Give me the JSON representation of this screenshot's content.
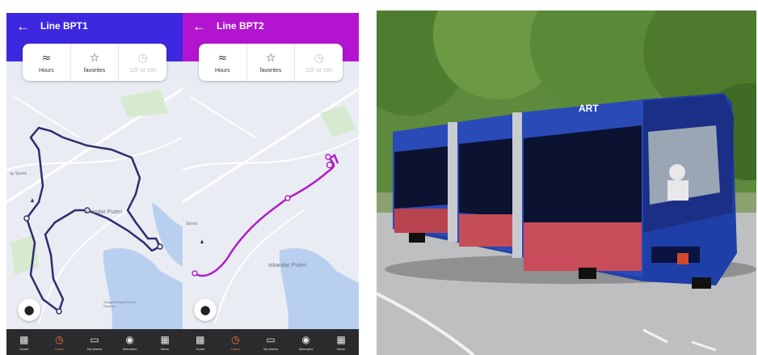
{
  "screens": [
    {
      "title": "Line BPT1",
      "route_color": "#2b2e6e",
      "appbar_color": "#3d28e0",
      "chips": [
        {
          "icon": "clock-schedule-icon",
          "label": "Hours"
        },
        {
          "icon": "star-icon",
          "label": "favorites"
        },
        {
          "icon": "clock-icon",
          "label": "12h at 18h"
        }
      ],
      "map_labels": [
        "Iskandar Puteri",
        "ay Sports",
        "Sungai Perepat Forest Reserve"
      ],
      "nav": [
        "Home",
        "Hours",
        "My tickets",
        "Itineraries",
        "Menu"
      ],
      "active_nav": "Hours"
    },
    {
      "title": "Line BPT2",
      "route_color": "#b01dc6",
      "appbar_color": "#b214cf",
      "chips": [
        {
          "icon": "clock-schedule-icon",
          "label": "Hours"
        },
        {
          "icon": "star-icon",
          "label": "favorites"
        },
        {
          "icon": "clock-icon",
          "label": "12h at 18h"
        }
      ],
      "map_labels": [
        "Iskandar Puteri",
        "Sports"
      ],
      "nav": [
        "Home",
        "Hours",
        "My tickets",
        "Itineraries",
        "Menu"
      ],
      "active_nav": "Hours"
    }
  ],
  "photo": {
    "subject": "blue articulated ART tram bus",
    "livery_text": "ART"
  }
}
